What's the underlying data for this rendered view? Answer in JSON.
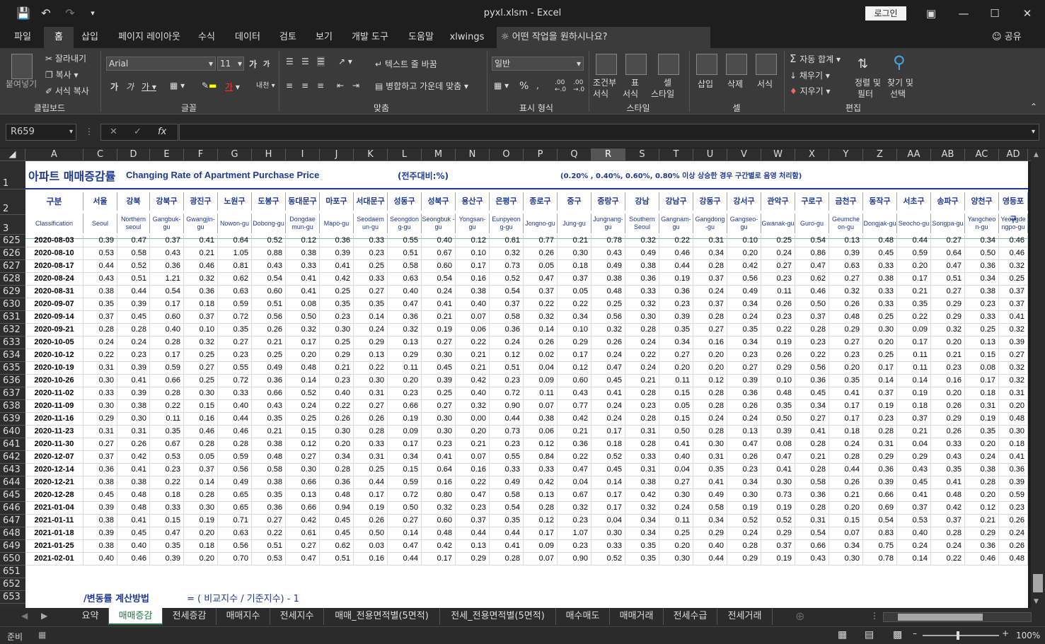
{
  "window": {
    "title": "pyxl.xlsm - Excel",
    "login": "로그인"
  },
  "ribbon_tabs": [
    "파일",
    "홈",
    "삽입",
    "페이지 레이아웃",
    "수식",
    "데이터",
    "검토",
    "보기",
    "개발 도구",
    "도움말",
    "xlwings"
  ],
  "tell_me": "어떤 작업을 원하시나요?",
  "share": "공유",
  "ribbon": {
    "clipboard": {
      "paste": "붙여넣기",
      "cut": "잘라내기",
      "copy": "복사",
      "format_painter": "서식 복사",
      "label": "클립보드"
    },
    "font": {
      "name": "Arial",
      "size": "11",
      "label": "글꼴"
    },
    "align": {
      "wrap": "텍스트 줄 바꿈",
      "merge": "병합하고 가운데 맞춤",
      "label": "맞춤"
    },
    "number": {
      "format": "일반",
      "label": "표시 형식"
    },
    "styles": {
      "cond": "조건부",
      "cond2": "서식",
      "table": "표",
      "table2": "서식",
      "cell": "셀",
      "cell2": "스타일",
      "label": "스타일"
    },
    "cells": {
      "insert": "삽입",
      "delete": "삭제",
      "format": "서식",
      "label": "셀"
    },
    "edit": {
      "autosum": "자동 합계",
      "fill": "채우기",
      "clear": "지우기",
      "sort": "정렬 및",
      "sort2": "필터",
      "find": "찾기 및",
      "find2": "선택",
      "label": "편집"
    }
  },
  "namebox": "R659",
  "columns": [
    "A",
    "C",
    "D",
    "E",
    "F",
    "G",
    "H",
    "I",
    "J",
    "K",
    "L",
    "M",
    "N",
    "O",
    "P",
    "Q",
    "R",
    "S",
    "T",
    "U",
    "V",
    "W",
    "X",
    "Y",
    "Z",
    "AA",
    "AB",
    "AC",
    "AD"
  ],
  "selected_column": "R",
  "sheet": {
    "title_kr": "아파트 매매증감률",
    "title_en": "Changing Rate of Apartment Purchase Price",
    "unit": "(전주대비:%)",
    "note": "(0.20% , 0.40%, 0.60%, 0.80% 이상 상승한 경우 구간별로 음영 처리함)",
    "hdr_kr": [
      "구분",
      "서울",
      "강북",
      "강북구",
      "광진구",
      "노원구",
      "도봉구",
      "동대문구",
      "마포구",
      "서대문구",
      "성동구",
      "성북구",
      "용산구",
      "은평구",
      "종로구",
      "중구",
      "중랑구",
      "강남",
      "강남구",
      "강동구",
      "강서구",
      "관악구",
      "구로구",
      "금천구",
      "동작구",
      "서초구",
      "송파구",
      "양천구",
      "영등포구"
    ],
    "hdr_en": [
      "Classification",
      "Seoul",
      "Northern seoul",
      "Gangbuk-gu",
      "Gwangjin-gu",
      "Nowon-gu",
      "Dobong-gu",
      "Dongdae mun-gu",
      "Mapo-gu",
      "Seodaem un-gu",
      "Seongdon g-gu",
      "Seongbuk -gu",
      "Yongsan-gu",
      "Eunpyeon g-gu",
      "Jongno-gu",
      "Jung-gu",
      "Jungnang-gu",
      "Southern Seoul",
      "Gangnam-gu",
      "Gangdong -gu",
      "Gangseo-gu",
      "Gwanak-gu",
      "Guro-gu",
      "Geumche on-gu",
      "Dongjak-gu",
      "Seocho-gu",
      "Songpa-gu",
      "Yangcheo n-gu",
      "Yeongde ngpo-gu"
    ],
    "row_numbers": [
      "1",
      "2",
      "3",
      "625",
      "626",
      "627",
      "628",
      "629",
      "630",
      "631",
      "632",
      "633",
      "634",
      "635",
      "636",
      "637",
      "638",
      "639",
      "640",
      "641",
      "642",
      "643",
      "644",
      "645",
      "646",
      "647",
      "648",
      "649",
      "650",
      "651",
      "652",
      "653"
    ],
    "rows": [
      [
        "2020-08-03",
        "0.39",
        "0.47",
        "0.37",
        "0.41",
        "0.64",
        "0.52",
        "0.12",
        "0.36",
        "0.33",
        "0.55",
        "0.40",
        "0.12",
        "0.61",
        "0.77",
        "0.21",
        "0.78",
        "0.32",
        "0.22",
        "0.31",
        "0.10",
        "0.25",
        "0.54",
        "0.13",
        "0.48",
        "0.44",
        "0.27",
        "0.34",
        "0.46"
      ],
      [
        "2020-08-10",
        "0.53",
        "0.58",
        "0.43",
        "0.21",
        "1.05",
        "0.88",
        "0.38",
        "0.39",
        "0.23",
        "0.51",
        "0.67",
        "0.10",
        "0.32",
        "0.26",
        "0.30",
        "0.43",
        "0.49",
        "0.46",
        "0.34",
        "0.20",
        "0.24",
        "0.86",
        "0.39",
        "0.45",
        "0.59",
        "0.64",
        "0.50",
        "0.46"
      ],
      [
        "2020-08-17",
        "0.44",
        "0.52",
        "0.36",
        "0.46",
        "0.81",
        "0.43",
        "0.33",
        "0.41",
        "0.25",
        "0.58",
        "0.60",
        "0.17",
        "0.73",
        "0.05",
        "0.18",
        "0.49",
        "0.38",
        "0.44",
        "0.28",
        "0.42",
        "0.27",
        "0.47",
        "0.63",
        "0.33",
        "0.20",
        "0.47",
        "0.36",
        "0.32"
      ],
      [
        "2020-08-24",
        "0.43",
        "0.51",
        "1.21",
        "0.32",
        "0.62",
        "0.54",
        "0.41",
        "0.42",
        "0.33",
        "0.63",
        "0.54",
        "0.16",
        "0.52",
        "0.47",
        "0.37",
        "0.38",
        "0.36",
        "0.19",
        "0.37",
        "0.56",
        "0.23",
        "0.62",
        "0.27",
        "0.38",
        "0.17",
        "0.51",
        "0.34",
        "0.25"
      ],
      [
        "2020-08-31",
        "0.38",
        "0.44",
        "0.54",
        "0.36",
        "0.63",
        "0.60",
        "0.41",
        "0.25",
        "0.27",
        "0.40",
        "0.24",
        "0.38",
        "0.54",
        "0.37",
        "0.05",
        "0.48",
        "0.33",
        "0.36",
        "0.24",
        "0.49",
        "0.11",
        "0.46",
        "0.32",
        "0.33",
        "0.21",
        "0.27",
        "0.38",
        "0.37"
      ],
      [
        "2020-09-07",
        "0.35",
        "0.39",
        "0.17",
        "0.18",
        "0.59",
        "0.51",
        "0.08",
        "0.35",
        "0.35",
        "0.47",
        "0.41",
        "0.40",
        "0.37",
        "0.22",
        "0.22",
        "0.25",
        "0.32",
        "0.23",
        "0.37",
        "0.34",
        "0.26",
        "0.50",
        "0.26",
        "0.33",
        "0.35",
        "0.29",
        "0.23",
        "0.37"
      ],
      [
        "2020-09-14",
        "0.37",
        "0.45",
        "0.60",
        "0.37",
        "0.72",
        "0.56",
        "0.50",
        "0.23",
        "0.14",
        "0.36",
        "0.21",
        "0.07",
        "0.58",
        "0.32",
        "0.34",
        "0.56",
        "0.30",
        "0.39",
        "0.28",
        "0.24",
        "0.23",
        "0.37",
        "0.48",
        "0.25",
        "0.22",
        "0.29",
        "0.33",
        "0.41"
      ],
      [
        "2020-09-21",
        "0.28",
        "0.28",
        "0.40",
        "0.10",
        "0.35",
        "0.26",
        "0.32",
        "0.30",
        "0.24",
        "0.32",
        "0.19",
        "0.06",
        "0.36",
        "0.14",
        "0.10",
        "0.32",
        "0.28",
        "0.35",
        "0.27",
        "0.35",
        "0.22",
        "0.28",
        "0.29",
        "0.30",
        "0.09",
        "0.32",
        "0.25",
        "0.32"
      ],
      [
        "2020-10-05",
        "0.24",
        "0.24",
        "0.28",
        "0.32",
        "0.27",
        "0.21",
        "0.17",
        "0.25",
        "0.29",
        "0.13",
        "0.27",
        "0.22",
        "0.24",
        "0.26",
        "0.29",
        "0.26",
        "0.24",
        "0.34",
        "0.16",
        "0.34",
        "0.19",
        "0.23",
        "0.27",
        "0.20",
        "0.17",
        "0.20",
        "0.13",
        "0.39"
      ],
      [
        "2020-10-12",
        "0.22",
        "0.23",
        "0.17",
        "0.25",
        "0.23",
        "0.25",
        "0.20",
        "0.29",
        "0.13",
        "0.29",
        "0.30",
        "0.21",
        "0.12",
        "0.02",
        "0.17",
        "0.24",
        "0.22",
        "0.27",
        "0.20",
        "0.23",
        "0.26",
        "0.22",
        "0.23",
        "0.25",
        "0.11",
        "0.21",
        "0.15",
        "0.27"
      ],
      [
        "2020-10-19",
        "0.31",
        "0.39",
        "0.59",
        "0.27",
        "0.55",
        "0.49",
        "0.48",
        "0.21",
        "0.22",
        "0.11",
        "0.45",
        "0.21",
        "0.51",
        "0.04",
        "0.12",
        "0.47",
        "0.24",
        "0.20",
        "0.20",
        "0.27",
        "0.29",
        "0.56",
        "0.20",
        "0.17",
        "0.11",
        "0.23",
        "0.08",
        "0.32"
      ],
      [
        "2020-10-26",
        "0.30",
        "0.41",
        "0.66",
        "0.25",
        "0.72",
        "0.36",
        "0.14",
        "0.23",
        "0.30",
        "0.20",
        "0.39",
        "0.42",
        "0.23",
        "0.09",
        "0.60",
        "0.45",
        "0.21",
        "0.11",
        "0.12",
        "0.39",
        "0.10",
        "0.36",
        "0.35",
        "0.14",
        "0.14",
        "0.16",
        "0.17",
        "0.32"
      ],
      [
        "2020-11-02",
        "0.33",
        "0.39",
        "0.28",
        "0.30",
        "0.33",
        "0.66",
        "0.52",
        "0.40",
        "0.31",
        "0.23",
        "0.25",
        "0.40",
        "0.72",
        "0.11",
        "0.43",
        "0.41",
        "0.28",
        "0.15",
        "0.28",
        "0.36",
        "0.48",
        "0.45",
        "0.41",
        "0.37",
        "0.19",
        "0.20",
        "0.18",
        "0.31"
      ],
      [
        "2020-11-09",
        "0.30",
        "0.38",
        "0.22",
        "0.15",
        "0.40",
        "0.43",
        "0.24",
        "0.22",
        "0.27",
        "0.66",
        "0.27",
        "0.32",
        "0.90",
        "0.07",
        "0.77",
        "0.24",
        "0.23",
        "0.05",
        "0.28",
        "0.26",
        "0.35",
        "0.34",
        "0.17",
        "0.19",
        "0.18",
        "0.26",
        "0.31",
        "0.20"
      ],
      [
        "2020-11-16",
        "0.29",
        "0.30",
        "0.11",
        "0.16",
        "0.44",
        "0.35",
        "0.25",
        "0.26",
        "0.26",
        "0.19",
        "0.30",
        "0.00",
        "0.44",
        "0.38",
        "0.42",
        "0.24",
        "0.28",
        "0.15",
        "0.24",
        "0.24",
        "0.50",
        "0.27",
        "0.17",
        "0.23",
        "0.37",
        "0.29",
        "0.19",
        "0.48"
      ],
      [
        "2020-11-23",
        "0.31",
        "0.31",
        "0.35",
        "0.46",
        "0.46",
        "0.21",
        "0.15",
        "0.30",
        "0.28",
        "0.09",
        "0.30",
        "0.20",
        "0.73",
        "0.06",
        "0.21",
        "0.17",
        "0.31",
        "0.50",
        "0.28",
        "0.13",
        "0.39",
        "0.41",
        "0.18",
        "0.28",
        "0.21",
        "0.26",
        "0.35",
        "0.30"
      ],
      [
        "2020-11-30",
        "0.27",
        "0.26",
        "0.67",
        "0.28",
        "0.28",
        "0.38",
        "0.12",
        "0.20",
        "0.33",
        "0.17",
        "0.23",
        "0.21",
        "0.23",
        "0.12",
        "0.36",
        "0.18",
        "0.28",
        "0.41",
        "0.30",
        "0.47",
        "0.08",
        "0.28",
        "0.24",
        "0.31",
        "0.04",
        "0.33",
        "0.20",
        "0.18"
      ],
      [
        "2020-12-07",
        "0.37",
        "0.42",
        "0.53",
        "0.05",
        "0.59",
        "0.48",
        "0.27",
        "0.34",
        "0.31",
        "0.34",
        "0.41",
        "0.07",
        "0.55",
        "0.84",
        "0.22",
        "0.52",
        "0.33",
        "0.40",
        "0.31",
        "0.26",
        "0.47",
        "0.21",
        "0.28",
        "0.29",
        "0.29",
        "0.43",
        "0.24",
        "0.41"
      ],
      [
        "2020-12-14",
        "0.36",
        "0.41",
        "0.23",
        "0.37",
        "0.56",
        "0.58",
        "0.30",
        "0.28",
        "0.25",
        "0.15",
        "0.64",
        "0.16",
        "0.33",
        "0.33",
        "0.47",
        "0.45",
        "0.31",
        "0.04",
        "0.35",
        "0.23",
        "0.41",
        "0.28",
        "0.44",
        "0.36",
        "0.43",
        "0.35",
        "0.38",
        "0.36"
      ],
      [
        "2020-12-21",
        "0.38",
        "0.38",
        "0.22",
        "0.14",
        "0.49",
        "0.38",
        "0.66",
        "0.36",
        "0.44",
        "0.59",
        "0.16",
        "0.22",
        "0.49",
        "0.42",
        "0.04",
        "0.14",
        "0.38",
        "0.27",
        "0.41",
        "0.34",
        "0.30",
        "0.58",
        "0.26",
        "0.39",
        "0.45",
        "0.41",
        "0.28",
        "0.39"
      ],
      [
        "2020-12-28",
        "0.45",
        "0.48",
        "0.18",
        "0.28",
        "0.65",
        "0.35",
        "0.13",
        "0.48",
        "0.17",
        "0.72",
        "0.80",
        "0.47",
        "0.58",
        "0.13",
        "0.67",
        "0.17",
        "0.42",
        "0.30",
        "0.49",
        "0.30",
        "0.73",
        "0.36",
        "0.21",
        "0.66",
        "0.41",
        "0.48",
        "0.20",
        "0.59"
      ],
      [
        "2021-01-04",
        "0.39",
        "0.48",
        "0.33",
        "0.30",
        "0.65",
        "0.36",
        "0.66",
        "0.94",
        "0.19",
        "0.50",
        "0.32",
        "0.23",
        "0.54",
        "0.28",
        "0.32",
        "0.17",
        "0.32",
        "0.24",
        "0.58",
        "0.19",
        "0.19",
        "0.28",
        "0.20",
        "0.69",
        "0.37",
        "0.42",
        "0.12",
        "0.23"
      ],
      [
        "2021-01-11",
        "0.38",
        "0.41",
        "0.15",
        "0.19",
        "0.71",
        "0.27",
        "0.42",
        "0.45",
        "0.26",
        "0.27",
        "0.60",
        "0.37",
        "0.35",
        "0.12",
        "0.23",
        "0.04",
        "0.34",
        "0.11",
        "0.34",
        "0.52",
        "0.52",
        "0.31",
        "0.15",
        "0.54",
        "0.53",
        "0.37",
        "0.21",
        "0.26"
      ],
      [
        "2021-01-18",
        "0.39",
        "0.45",
        "0.47",
        "0.20",
        "0.63",
        "0.22",
        "0.61",
        "0.45",
        "0.50",
        "0.14",
        "0.48",
        "0.44",
        "0.44",
        "0.17",
        "1.07",
        "0.30",
        "0.34",
        "0.25",
        "0.29",
        "0.24",
        "0.29",
        "0.54",
        "0.07",
        "0.83",
        "0.40",
        "0.28",
        "0.29",
        "0.24"
      ],
      [
        "2021-01-25",
        "0.38",
        "0.40",
        "0.35",
        "0.18",
        "0.56",
        "0.51",
        "0.27",
        "0.62",
        "0.03",
        "0.47",
        "0.42",
        "0.13",
        "0.41",
        "0.09",
        "0.23",
        "0.33",
        "0.35",
        "0.20",
        "0.40",
        "0.28",
        "0.37",
        "0.66",
        "0.34",
        "0.75",
        "0.24",
        "0.24",
        "0.36",
        "0.26"
      ],
      [
        "2021-02-01",
        "0.40",
        "0.46",
        "0.39",
        "0.20",
        "0.70",
        "0.53",
        "0.47",
        "0.51",
        "0.16",
        "0.44",
        "0.17",
        "0.29",
        "0.28",
        "0.07",
        "0.90",
        "0.52",
        "0.35",
        "0.30",
        "0.44",
        "0.29",
        "0.19",
        "0.43",
        "0.30",
        "0.78",
        "0.14",
        "0.22",
        "0.46",
        "0.48"
      ]
    ],
    "formula_label": "/변동률 계산방법",
    "formula": "= ( 비교지수 / 기준지수) - 1"
  },
  "sheet_tabs": [
    "요약",
    "매매증감",
    "전세증감",
    "매매지수",
    "전세지수",
    "매매_전용면적별(5면적)",
    "전세_전용면적별(5면적)",
    "매수매도",
    "매매거래",
    "전세수급",
    "전세거래"
  ],
  "active_sheet": "매매증감",
  "status": {
    "ready": "준비",
    "zoom": "100%"
  }
}
